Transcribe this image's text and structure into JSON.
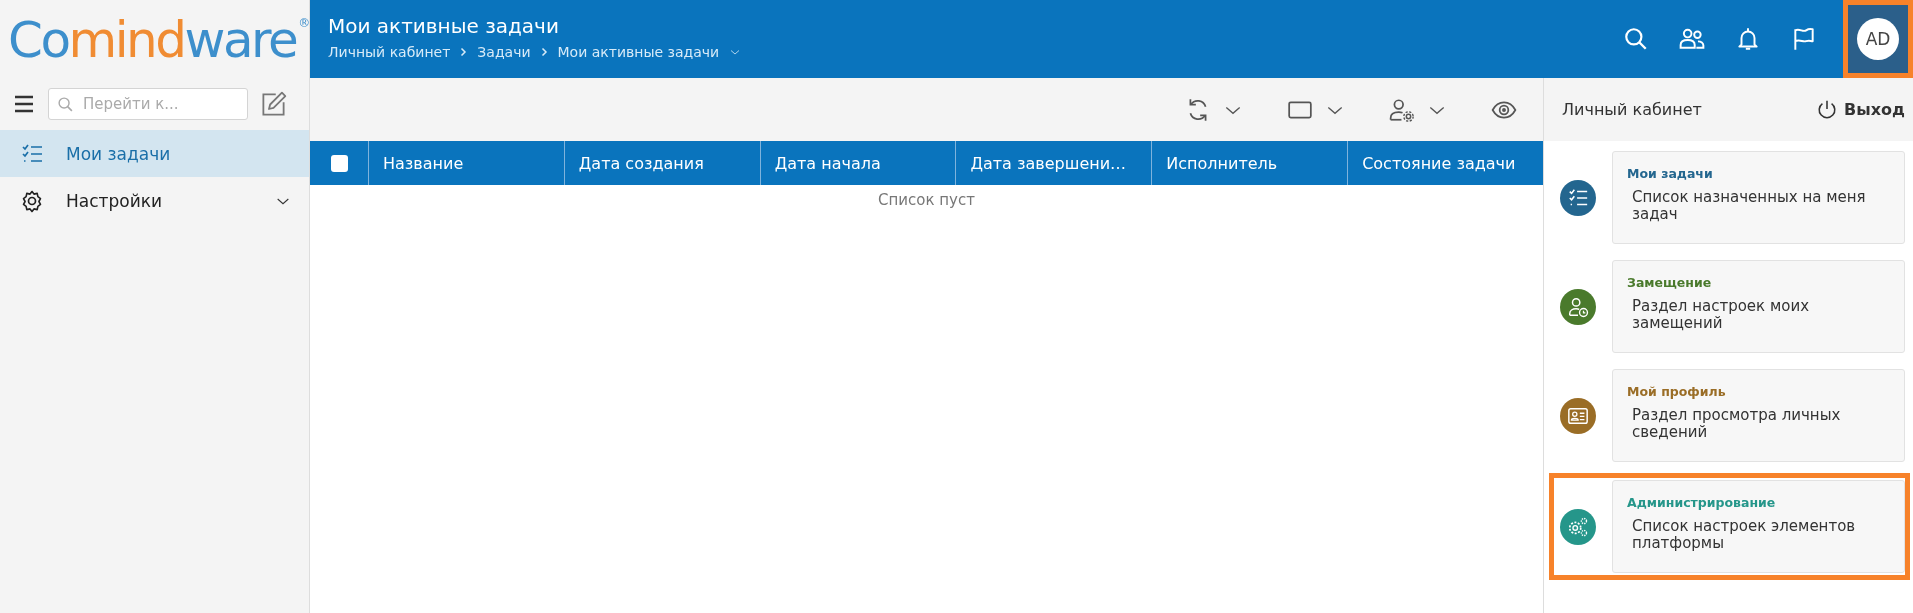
{
  "logo": {
    "parts": [
      {
        "text": "Co",
        "color": "#3d8fcc"
      },
      {
        "text": "mind",
        "color": "#f08c33"
      },
      {
        "text": "ware",
        "color": "#3d8fcc"
      }
    ],
    "mark": "®"
  },
  "sidebar": {
    "search": {
      "placeholder": "Перейти к..."
    },
    "items": [
      {
        "label": "Мои задачи",
        "selected": true,
        "expandable": false
      },
      {
        "label": "Настройки",
        "selected": false,
        "expandable": true
      }
    ]
  },
  "header": {
    "title": "Мои активные задачи",
    "breadcrumbs": [
      "Личный кабинет",
      "Задачи",
      "Мои активные задачи"
    ],
    "avatar": {
      "initials": "AD",
      "highlighted": true
    }
  },
  "table": {
    "all_checked": false,
    "columns": [
      "Название",
      "Дата создания",
      "Дата начала",
      "Дата завершени…",
      "Исполнитель",
      "Состояние задачи"
    ],
    "empty_text": "Список пуст"
  },
  "panel": {
    "title": "Личный кабинет",
    "logout": "Выход",
    "cards": [
      {
        "title": "Мои задачи",
        "text": "Список назначенных на меня задач",
        "color": "#23668f",
        "highlighted": false
      },
      {
        "title": "Замещение",
        "text": "Раздел настроек моих замещений",
        "color": "#4a7a2c",
        "highlighted": false
      },
      {
        "title": "Мой профиль",
        "text": "Раздел просмотра личных сведений",
        "color": "#9a6d26",
        "highlighted": false
      },
      {
        "title": "Администрирование",
        "text": "Список настроек элементов платформы",
        "color": "#25968a",
        "highlighted": true
      }
    ]
  }
}
